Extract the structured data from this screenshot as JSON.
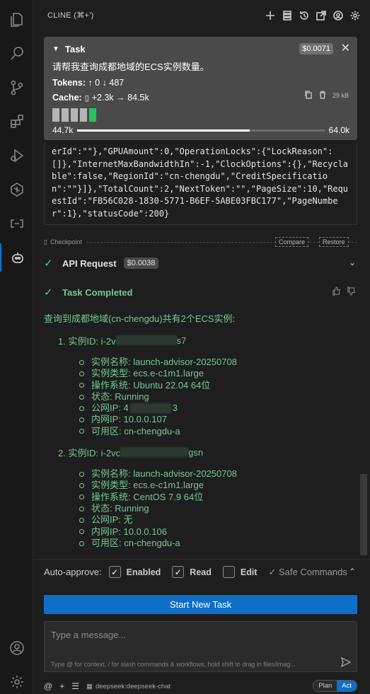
{
  "header": {
    "title": "CLINE (⌘+')"
  },
  "task": {
    "label": "Task",
    "cost": "$0.0071",
    "text": "请帮我查询成都地域的ECS实例数量。",
    "tokens_label": "Tokens:",
    "tokens_in": "↑ 0",
    "tokens_out": "↓ 487",
    "cache_label": "Cache:",
    "cache_value": "+2.3k → 84.5k",
    "size": "29 kB",
    "context_used": "44.7k",
    "context_max": "64.0k",
    "context_fraction": 0.698
  },
  "code_output": "erId\":\"\"},\"GPUAmount\":0,\"OperationLocks\":{\"LockReason\":[]},\"InternetMaxBandwidthIn\":-1,\"ClockOptions\":{},\"Recyclable\":false,\"RegionId\":\"cn-chengdu\",\"CreditSpecification\":\"\"}]},\"TotalCount\":2,\"NextToken\":\"\",\"PageSize\":10,\"RequestId\":\"FB56C028-1830-5771-B6EF-5ABE03FBC177\",\"PageNumber\":1},\"statusCode\":200}",
  "checkpoint": {
    "label": "Checkpoint",
    "compare": "Compare",
    "restore": "Restore"
  },
  "api_request": {
    "title": "API Request",
    "cost": "$0.0038"
  },
  "task_completed": {
    "title": "Task Completed"
  },
  "result": {
    "intro": "查询到成都地域(cn-chengdu)共有2个ECS实例:",
    "instances": [
      {
        "head_prefix": "1. 实例ID: i-2v",
        "head_suffix": "s7",
        "details": [
          "实例名称: launch-advisor-20250708",
          "实例类型: ecs.e-c1m1.large",
          "操作系统: Ubuntu 22.04 64位",
          "状态: Running",
          "公网IP: 4",
          "内网IP: 10.0.0.107",
          "可用区: cn-chengdu-a"
        ],
        "ip_suffix": "3"
      },
      {
        "head_prefix": "2. 实例ID: i-2vc",
        "head_suffix": "gsn",
        "details": [
          "实例名称: launch-advisor-20250708",
          "实例类型: ecs.e-c1m1.large",
          "操作系统: CentOS 7.9 64位",
          "状态: Running",
          "公网IP: 无",
          "内网IP: 10.0.0.106",
          "可用区: cn-chengdu-a"
        ]
      }
    ]
  },
  "auto_approve": {
    "label": "Auto-approve:",
    "enabled": "Enabled",
    "read": "Read",
    "edit": "Edit",
    "safe": "✓ Safe Commands"
  },
  "start_button": "Start New Task",
  "message": {
    "placeholder": "Type a message...",
    "hint": "Type @ for context, / for slash commands & workflows, hold shift to drag in files/imag..."
  },
  "footer": {
    "model": "deepseek:deepseek-chat",
    "plan": "Plan",
    "act": "Act"
  }
}
